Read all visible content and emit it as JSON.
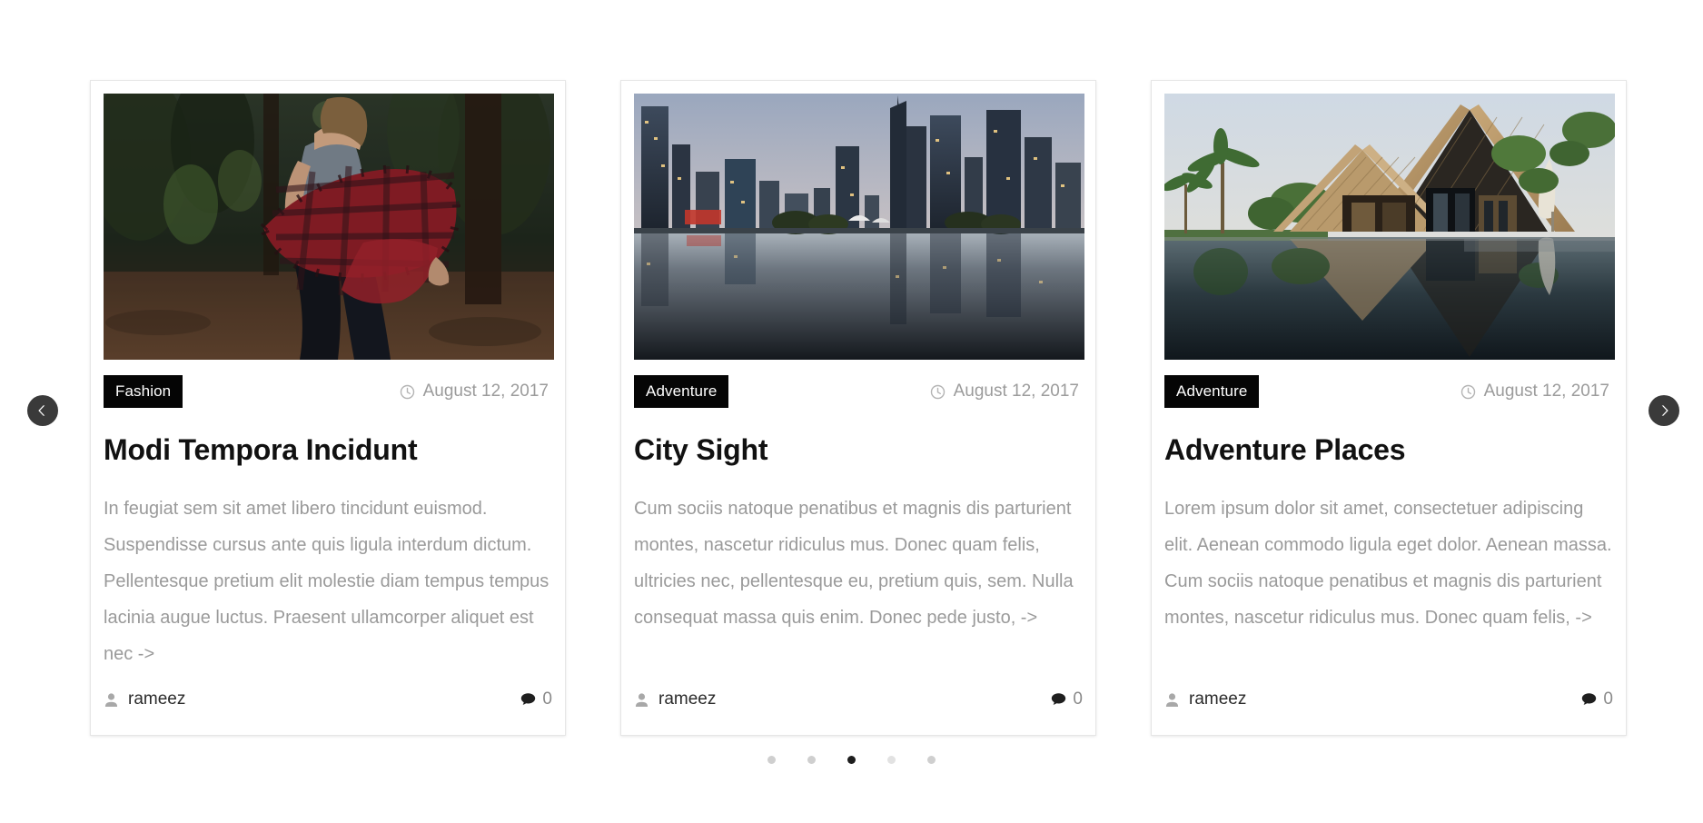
{
  "carousel": {
    "prev_label": "Previous slide",
    "next_label": "Next slide",
    "prev_icon": "chevron-left-icon",
    "next_icon": "chevron-right-icon",
    "active_dot_index": 2,
    "dot_count": 5,
    "colors": {
      "badge_background": "#050505",
      "badge_text": "#ffffff",
      "title_text": "#111111",
      "body_text": "#9a9a9a",
      "meta_text": "#9b9b9b",
      "card_border": "#e6e6e6",
      "arrow_background": "#3a3a3a",
      "dot_active": "#1d1d1d",
      "dot_inactive": "#cfcfcf"
    }
  },
  "cards": [
    {
      "category": "Fashion",
      "date": "August 12, 2017",
      "date_icon": "clock-icon",
      "title": "Modi Tempora Incidunt",
      "excerpt": "In feugiat sem sit amet libero tincidunt euismod. Suspendisse cursus ante quis ligula interdum dictum. Pellentesque pretium elit molestie diam tempus tempus lacinia augue luctus. Praesent ullamcorper aliquet est nec ->",
      "author": "rameez",
      "author_icon": "user-icon",
      "comment_count": "0",
      "comment_icon": "comment-icon",
      "image_alt": "Woman in red plaid shirt walking in a forest"
    },
    {
      "category": "Adventure",
      "date": "August 12, 2017",
      "date_icon": "clock-icon",
      "title": "City Sight",
      "excerpt": "Cum sociis natoque penatibus et magnis dis parturient montes, nascetur ridiculus mus. Donec quam felis, ultricies nec, pellentesque eu, pretium quis, sem. Nulla consequat massa quis enim. Donec pede justo, ->",
      "author": "rameez",
      "author_icon": "user-icon",
      "comment_count": "0",
      "comment_icon": "comment-icon",
      "image_alt": "City skyline at dusk reflected in still water"
    },
    {
      "category": "Adventure",
      "date": "August 12, 2017",
      "date_icon": "clock-icon",
      "title": "Adventure Places",
      "excerpt": "Lorem ipsum dolor sit amet, consectetuer adipiscing elit. Aenean commodo ligula eget dolor. Aenean massa. Cum sociis natoque penatibus et magnis dis parturient montes, nascetur ridiculus mus. Donec quam felis, ->",
      "author": "rameez",
      "author_icon": "user-icon",
      "comment_count": "0",
      "comment_icon": "comment-icon",
      "image_alt": "Tropical thatched-roof villa beside an infinity pool"
    }
  ]
}
